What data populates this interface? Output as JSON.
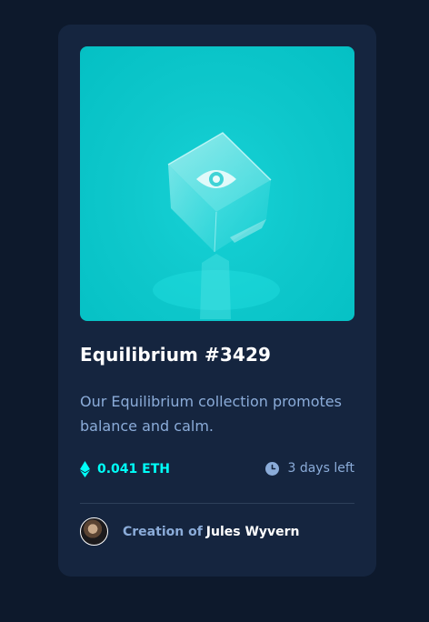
{
  "card": {
    "title": "Equilibrium #3429",
    "description": "Our Equilibrium collection promotes balance and calm.",
    "price": "0.041 ETH",
    "time_left": "3 days left",
    "creator_prefix": "Creation of",
    "creator_name": "Jules Wyvern"
  },
  "icons": {
    "price": "ethereum-icon",
    "time": "clock-icon",
    "hero_overlay": "eye-icon"
  },
  "colors": {
    "page_background": "#0d192c",
    "card_background": "#15253f",
    "accent_cyan": "#00fff8",
    "soft_blue": "#8bacd9",
    "white": "#ffffff",
    "divider": "#2e405a"
  }
}
